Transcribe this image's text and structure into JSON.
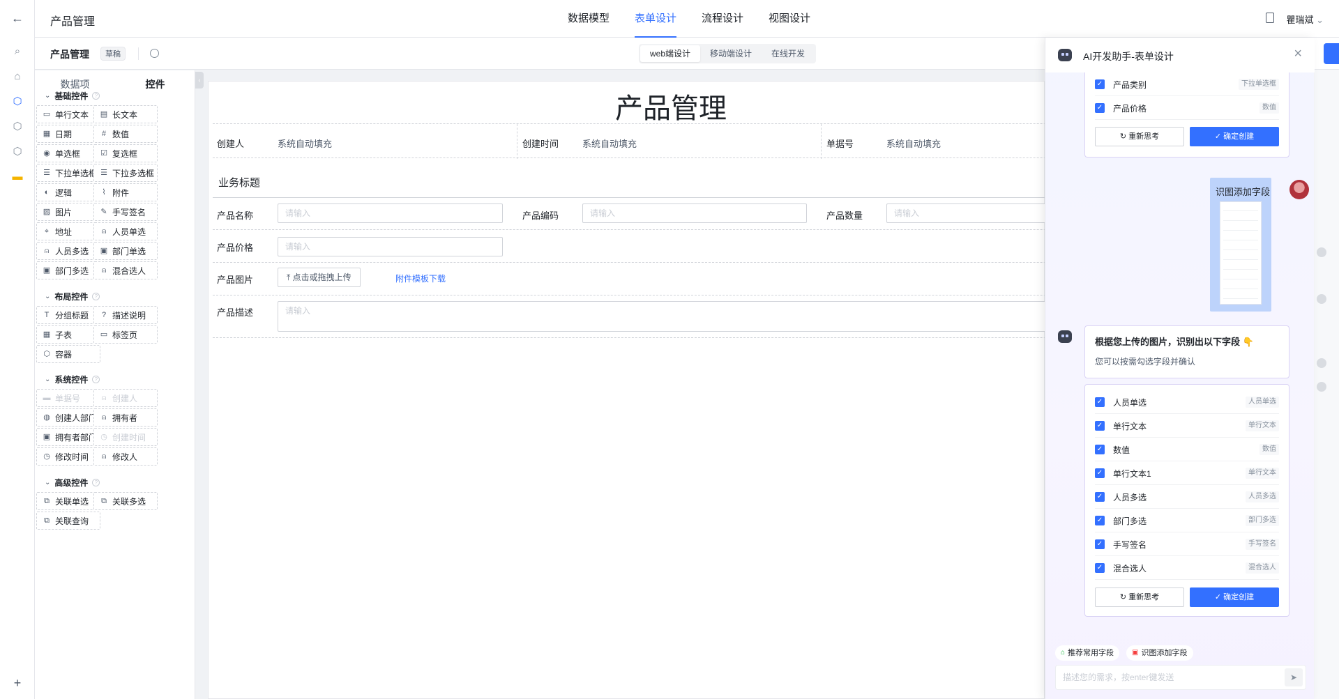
{
  "app": {
    "title": "产品管理",
    "user": "瞿瑞斌"
  },
  "top_tabs": [
    "数据模型",
    "表单设计",
    "流程设计",
    "视图设计"
  ],
  "subbar": {
    "name": "产品管理",
    "badge": "草稿",
    "modes": [
      "web端设计",
      "移动端设计",
      "在线开发"
    ]
  },
  "panel": {
    "tabs": [
      "数据项",
      "控件"
    ],
    "groups": {
      "basic": {
        "title": "基础控件",
        "items": [
          "单行文本",
          "长文本",
          "日期",
          "数值",
          "单选框",
          "复选框",
          "下拉单选框",
          "下拉多选框",
          "逻辑",
          "附件",
          "图片",
          "手写签名",
          "地址",
          "人员单选",
          "人员多选",
          "部门单选",
          "部门多选",
          "混合选人"
        ]
      },
      "layout": {
        "title": "布局控件",
        "items": [
          "分组标题",
          "描述说明",
          "子表",
          "标签页",
          "容器"
        ]
      },
      "system": {
        "title": "系统控件",
        "items": [
          "单据号",
          "创建人",
          "创建人部门",
          "拥有者",
          "拥有者部门",
          "创建时间",
          "修改时间",
          "修改人"
        ]
      },
      "advanced": {
        "title": "高级控件",
        "items": [
          "关联单选",
          "关联多选",
          "关联查询"
        ]
      }
    }
  },
  "form": {
    "title": "产品管理",
    "sys_fields": [
      {
        "label": "创建人",
        "value": "系统自动填充"
      },
      {
        "label": "创建时间",
        "value": "系统自动填充"
      },
      {
        "label": "单据号",
        "value": "系统自动填充"
      }
    ],
    "section_title": "业务标题",
    "fields": {
      "name": {
        "label": "产品名称",
        "placeholder": "请输入"
      },
      "code": {
        "label": "产品编码",
        "placeholder": "请输入"
      },
      "qty": {
        "label": "产品数量",
        "placeholder": "请输入"
      },
      "price": {
        "label": "产品价格",
        "placeholder": "请输入"
      },
      "image": {
        "label": "产品图片",
        "upload": "点击或拖拽上传",
        "template_link": "附件模板下载"
      },
      "desc": {
        "label": "产品描述",
        "placeholder": "请输入"
      }
    }
  },
  "ai": {
    "title": "AI开发助手-表单设计",
    "card1_rows": [
      {
        "label": "产品类别",
        "type": "下拉单选框"
      },
      {
        "label": "产品价格",
        "type": "数值"
      }
    ],
    "rethink": "重新思考",
    "confirm": "确定创建",
    "user_msg": "识图添加字段",
    "reply_title": "根据您上传的图片，识别出以下字段 👇",
    "reply_sub": "您可以按需勾选字段并确认",
    "card2_rows": [
      {
        "label": "人员单选",
        "type": "人员单选"
      },
      {
        "label": "单行文本",
        "type": "单行文本"
      },
      {
        "label": "数值",
        "type": "数值"
      },
      {
        "label": "单行文本1",
        "type": "单行文本"
      },
      {
        "label": "人员多选",
        "type": "人员多选"
      },
      {
        "label": "部门多选",
        "type": "部门多选"
      },
      {
        "label": "手写签名",
        "type": "手写签名"
      },
      {
        "label": "混合选人",
        "type": "混合选人"
      }
    ],
    "chips": [
      "推荐常用字段",
      "识图添加字段"
    ],
    "input_placeholder": "描述您的需求，按enter键发送"
  },
  "icons": {
    "back": "back-arrow-icon",
    "search": "search-icon",
    "home": "home-icon",
    "cube": "cube-icon",
    "folder": "folder-icon",
    "plus": "plus-icon"
  },
  "colors": {
    "accent": "#3370ff"
  }
}
